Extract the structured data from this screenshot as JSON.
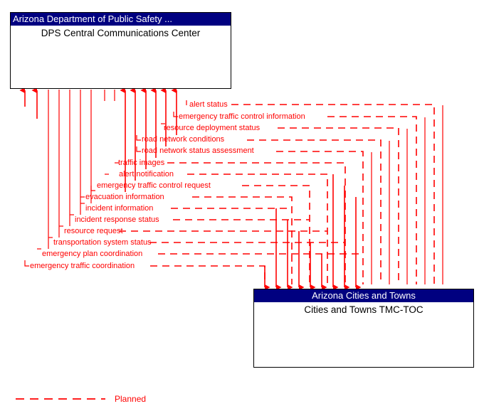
{
  "diagram": {
    "title": "Arizona Department of Public Safety interconnect diagram",
    "line_color": "#ff0000",
    "node_title_bg": "#000080",
    "node_title_fg": "#ffffff",
    "node_body_fg": "#000000"
  },
  "nodes": [
    {
      "id": "dps",
      "title": "Arizona Department of Public Safety ...",
      "subtitle": "DPS Central Communications Center"
    },
    {
      "id": "cities",
      "title": "Arizona Cities and Towns",
      "subtitle": "Cities and Towns TMC-TOC"
    }
  ],
  "flows": [
    {
      "label": "alert status",
      "direction": "to-dps"
    },
    {
      "label": "emergency traffic control information",
      "direction": "to-dps"
    },
    {
      "label": "resource deployment status",
      "direction": "to-dps"
    },
    {
      "label": "road network conditions",
      "direction": "to-dps"
    },
    {
      "label": "road network status assessment",
      "direction": "to-dps"
    },
    {
      "label": "traffic images",
      "direction": "to-dps"
    },
    {
      "label": "alert notification",
      "direction": "to-cities"
    },
    {
      "label": "emergency traffic control request",
      "direction": "to-cities"
    },
    {
      "label": "evacuation information",
      "direction": "to-cities"
    },
    {
      "label": "incident information",
      "direction": "to-cities"
    },
    {
      "label": "incident response status",
      "direction": "to-cities"
    },
    {
      "label": "resource request",
      "direction": "to-cities"
    },
    {
      "label": "transportation system status",
      "direction": "to-cities"
    },
    {
      "label": "emergency plan coordination",
      "direction": "both"
    },
    {
      "label": "emergency traffic coordination",
      "direction": "both"
    }
  ],
  "legend": {
    "label": "Planned",
    "color": "#ff0000",
    "style": "dashed"
  }
}
